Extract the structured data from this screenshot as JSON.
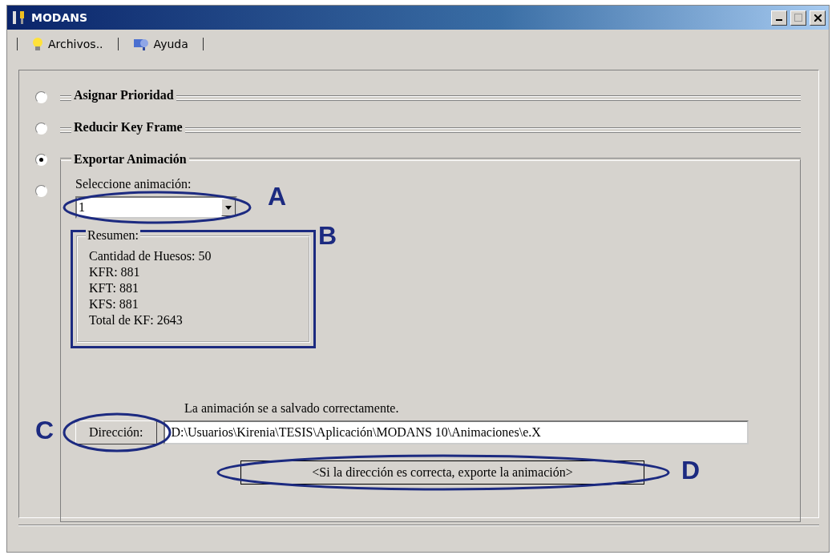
{
  "window": {
    "title": "MODANS"
  },
  "menu": [
    {
      "label": "Archivos.."
    },
    {
      "label": "Ayuda"
    }
  ],
  "radios": [
    {
      "selected": false
    },
    {
      "selected": false
    },
    {
      "selected": true
    },
    {
      "selected": false
    }
  ],
  "sections": [
    {
      "title": "Asignar Prioridad",
      "expanded": false
    },
    {
      "title": "Reducir Key Frame",
      "expanded": false
    },
    {
      "title": "Exportar Animación",
      "expanded": true
    }
  ],
  "export": {
    "select_label": "Seleccione animación:",
    "select_value": "1",
    "summary": {
      "title": "Resumen:",
      "lines": [
        "Cantidad de Huesos: 50",
        "KFR: 881",
        "KFT: 881",
        "KFS: 881",
        "Total de KF: 2643"
      ]
    },
    "status": "La animación se a salvado correctamente.",
    "address_button": "Dirección:",
    "address_value": "D:\\Usuarios\\Kirenia\\TESIS\\Aplicación\\MODANS 10\\Animaciones\\e.X",
    "export_button": "<Si la dirección es correcta, exporte la animación>"
  },
  "annotations": [
    "A",
    "B",
    "C",
    "D"
  ]
}
